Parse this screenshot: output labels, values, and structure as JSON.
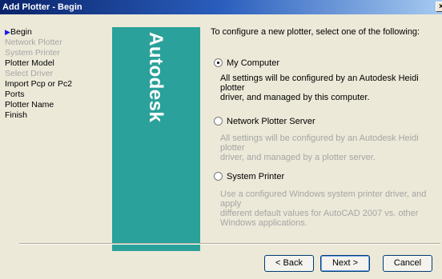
{
  "window": {
    "title": "Add Plotter - Begin",
    "close_glyph": "×"
  },
  "steps": [
    {
      "label": "Begin",
      "state": "current"
    },
    {
      "label": "Network Plotter",
      "state": "disabled"
    },
    {
      "label": "System Printer",
      "state": "disabled"
    },
    {
      "label": "Plotter Model",
      "state": "enabled"
    },
    {
      "label": "Select Driver",
      "state": "disabled"
    },
    {
      "label": "Import Pcp or Pc2",
      "state": "enabled"
    },
    {
      "label": "Ports",
      "state": "enabled"
    },
    {
      "label": "Plotter Name",
      "state": "enabled"
    },
    {
      "label": "Finish",
      "state": "enabled"
    }
  ],
  "brand": {
    "text": "Autodesk",
    "color": "#2aa19a"
  },
  "content": {
    "intro": "To configure a new plotter, select one of the following:",
    "options": [
      {
        "label": "My Computer",
        "checked": true,
        "desc_lines": [
          "All settings will be configured by an Autodesk Heidi plotter",
          "driver, and managed by this computer."
        ],
        "dim": false
      },
      {
        "label": "Network Plotter Server",
        "checked": false,
        "desc_lines": [
          "All settings will be configured by an Autodesk Heidi plotter",
          "driver, and managed by a plotter server."
        ],
        "dim": true
      },
      {
        "label": "System Printer",
        "checked": false,
        "desc_lines": [
          "Use a configured Windows system printer driver, and apply",
          "different default values for AutoCAD 2007 vs. other",
          "Windows applications."
        ],
        "dim": true
      }
    ]
  },
  "buttons": {
    "back": "< Back",
    "next": "Next >",
    "cancel": "Cancel"
  }
}
